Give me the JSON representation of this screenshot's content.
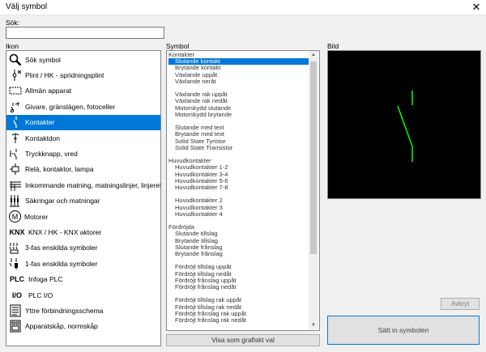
{
  "window": {
    "title": "Välj symbol",
    "close_glyph": "✕"
  },
  "search": {
    "label": "Sök:",
    "value": ""
  },
  "icon_panel": {
    "label": "Ikon",
    "items": [
      {
        "label": "Sök symbol",
        "icon": "magnifier-icon"
      },
      {
        "label": "Plint / HK - spridningsplint",
        "icon": "terminal-icon"
      },
      {
        "label": "Allmän apparat",
        "icon": "device-box-icon"
      },
      {
        "label": "Givare, gränslägen, fotoceller",
        "icon": "sensor-icon"
      },
      {
        "label": "Kontakter",
        "icon": "contact-icon",
        "selected": true
      },
      {
        "label": "Kontaktdon",
        "icon": "connector-icon"
      },
      {
        "label": "Tryckknapp, vred",
        "icon": "pushbutton-icon"
      },
      {
        "label": "Relä, kontaktor, lampa",
        "icon": "relay-icon"
      },
      {
        "label": "Inkommande matning, matningslinjer, linjereferer",
        "icon": "supply-lines-icon"
      },
      {
        "label": "Säkringar och matningar",
        "icon": "fuse-icon"
      },
      {
        "label": "Motorer",
        "icon": "motor-icon",
        "glyph": "M"
      },
      {
        "label": "KNX / HK - KNX aktorer",
        "icon": "knx-icon",
        "glyph": "KNX"
      },
      {
        "label": "3-fas enskilda symboler",
        "icon": "three-phase-icon"
      },
      {
        "label": "1-fas enskilda symboler",
        "icon": "single-phase-icon"
      },
      {
        "label": "Infoga PLC",
        "icon": "plc-icon",
        "glyph": "PLC"
      },
      {
        "label": "PLC I/O",
        "icon": "plc-io-icon",
        "glyph": "I/O"
      },
      {
        "label": "Yttre förbindningsschema",
        "icon": "wiring-diagram-icon"
      },
      {
        "label": "Apparatskåp, normskåp",
        "icon": "cabinet-icon"
      }
    ]
  },
  "symbol_panel": {
    "label": "Symbol",
    "rows": [
      {
        "text": "Kontakter",
        "kind": "cat"
      },
      {
        "text": "Slutande kontakt",
        "kind": "sub",
        "selected": true
      },
      {
        "text": "Brytande kontakt",
        "kind": "sub"
      },
      {
        "text": "Växlande uppåt",
        "kind": "sub"
      },
      {
        "text": "Växlande neråt",
        "kind": "sub"
      },
      {
        "text": "",
        "kind": "gap"
      },
      {
        "text": "Växlande rak uppåt",
        "kind": "sub"
      },
      {
        "text": "Växlande rak nedåt",
        "kind": "sub"
      },
      {
        "text": "Motorskydd slutande",
        "kind": "sub"
      },
      {
        "text": "Motorskydd brytande",
        "kind": "sub"
      },
      {
        "text": "",
        "kind": "gap"
      },
      {
        "text": "Slutande med text",
        "kind": "sub"
      },
      {
        "text": "Brytande med text",
        "kind": "sub"
      },
      {
        "text": "Solid State Tyristor",
        "kind": "sub"
      },
      {
        "text": "Solid State Transistor",
        "kind": "sub"
      },
      {
        "text": "",
        "kind": "gap"
      },
      {
        "text": "Huvudkontakter",
        "kind": "cat"
      },
      {
        "text": "Huvudkontakter 1-2",
        "kind": "sub"
      },
      {
        "text": "Huvudkontakter 3-4",
        "kind": "sub"
      },
      {
        "text": "Huvudkontakter 5-6",
        "kind": "sub"
      },
      {
        "text": "Huvudkontakter 7-8",
        "kind": "sub"
      },
      {
        "text": "",
        "kind": "gap"
      },
      {
        "text": "Huvudkontakter 2",
        "kind": "sub"
      },
      {
        "text": "Huvudkontakter 3",
        "kind": "sub"
      },
      {
        "text": "Huvudkontakter 4",
        "kind": "sub"
      },
      {
        "text": "",
        "kind": "gap"
      },
      {
        "text": "Fördröjda",
        "kind": "cat"
      },
      {
        "text": "Slutande tillslag",
        "kind": "sub"
      },
      {
        "text": "Brytande tillslag",
        "kind": "sub"
      },
      {
        "text": "Slutande frånslag",
        "kind": "sub"
      },
      {
        "text": "Brytande frånslag",
        "kind": "sub"
      },
      {
        "text": "",
        "kind": "gap"
      },
      {
        "text": "Fördröjt tillslag uppåt",
        "kind": "sub"
      },
      {
        "text": "Fördröjt tillslag nedåt",
        "kind": "sub"
      },
      {
        "text": "Fördröjt frånslag uppåt",
        "kind": "sub"
      },
      {
        "text": "Fördröjt frånslag nedåt",
        "kind": "sub"
      },
      {
        "text": "",
        "kind": "gap"
      },
      {
        "text": "Fördröjt tillslag rak uppåt",
        "kind": "sub"
      },
      {
        "text": "Fördröjt tillslag rak nedåt",
        "kind": "sub"
      },
      {
        "text": "Fördröjt frånslag rak uppåt",
        "kind": "sub"
      },
      {
        "text": "Fördröjt frånslag rak nedåt",
        "kind": "sub"
      }
    ],
    "graphic_button": "Visa som grafiskt val"
  },
  "preview_panel": {
    "label": "Bild",
    "symbol_color": "#00ff00"
  },
  "buttons": {
    "cancel": "Avbryt",
    "insert": "Sätt in symbolen"
  },
  "colors": {
    "selection": "#0078d7"
  }
}
